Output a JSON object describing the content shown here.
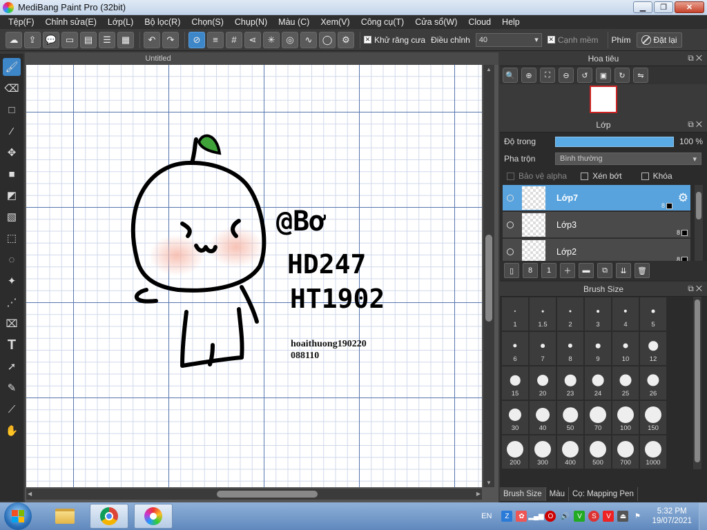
{
  "window": {
    "title": "MediBang Paint Pro (32bit)",
    "minimize": "▁",
    "maximize": "❐",
    "close": "✕"
  },
  "menu": [
    "Tệp(F)",
    "Chỉnh sửa(E)",
    "Lớp(L)",
    "Bộ lọc(R)",
    "Chọn(S)",
    "Chụp(N)",
    "Màu (C)",
    "Xem(V)",
    "Công cụ(T)",
    "Cửa sổ(W)",
    "Cloud",
    "Help"
  ],
  "toolbar": {
    "antialias_label": "Khử răng cưa",
    "antialias_checked": true,
    "adjust_label": "Điều chỉnh",
    "adjust_value": "40",
    "soft_edge_label": "Cạnh mềm",
    "key_label": "Phím",
    "reset_label": "Đặt lại"
  },
  "document": {
    "tab_title": "Untitled"
  },
  "canvas": {
    "text_at": "@Bơ",
    "text_hd": "HD247",
    "text_ht": "HT1902",
    "watermark_line1": "hoaithuong190220",
    "watermark_line2": "088110"
  },
  "navigator": {
    "title": "Hoa tiêu"
  },
  "layer_panel": {
    "title": "Lớp",
    "opacity_label": "Độ trong",
    "opacity_value": "100 %",
    "opacity": 1.0,
    "blend_label": "Pha trộn",
    "blend_value": "Bình thường",
    "protect_alpha": "Bảo vệ alpha",
    "clipping": "Xén bớt",
    "lock": "Khóa",
    "layers": [
      {
        "name": "Lớp7",
        "depth": "8",
        "selected": true
      },
      {
        "name": "Lớp3",
        "depth": "8",
        "selected": false
      },
      {
        "name": "Lớp2",
        "depth": "8",
        "selected": false
      }
    ]
  },
  "brush_panel": {
    "title": "Brush Size",
    "sizes": [
      "1",
      "1.5",
      "2",
      "3",
      "4",
      "5",
      "6",
      "7",
      "8",
      "9",
      "10",
      "12",
      "15",
      "20",
      "23",
      "24",
      "25",
      "26",
      "30",
      "40",
      "50",
      "70",
      "100",
      "150",
      "200",
      "300",
      "400",
      "500",
      "700",
      "1000"
    ]
  },
  "bottom_tabs": [
    "Brush Size",
    "Màu",
    "Cọ: Mapping Pen"
  ],
  "taskbar": {
    "lang": "EN",
    "time": "5:32 PM",
    "date": "19/07/2021"
  },
  "colors": {
    "accent": "#3d86c8",
    "layer_selected": "#58a3dd",
    "grid_major": "#5575ad"
  }
}
